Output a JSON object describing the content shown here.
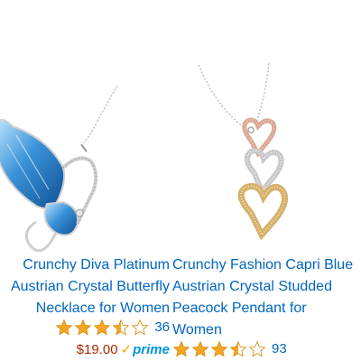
{
  "products": [
    {
      "title_lines": [
        "Crunchy Diva Platinum",
        "Austrian Crystal Butterfly",
        "Necklace for Women"
      ],
      "rating": 3.5,
      "review_count": "36",
      "price": "$19.00",
      "prime_label": "prime",
      "image_icon": "butterfly-pendant-icon"
    },
    {
      "title_lines": [
        "Crunchy Fashion Capri Blue",
        "Austrian Crystal Studded",
        "Peacock Pendant for",
        "Women"
      ],
      "rating": 3.5,
      "review_count": "93",
      "image_icon": "heart-pendant-icon"
    }
  ],
  "colors": {
    "link": "#0066c0",
    "price": "#b12704",
    "star": "#f5a623",
    "prime": "#0095d9"
  }
}
